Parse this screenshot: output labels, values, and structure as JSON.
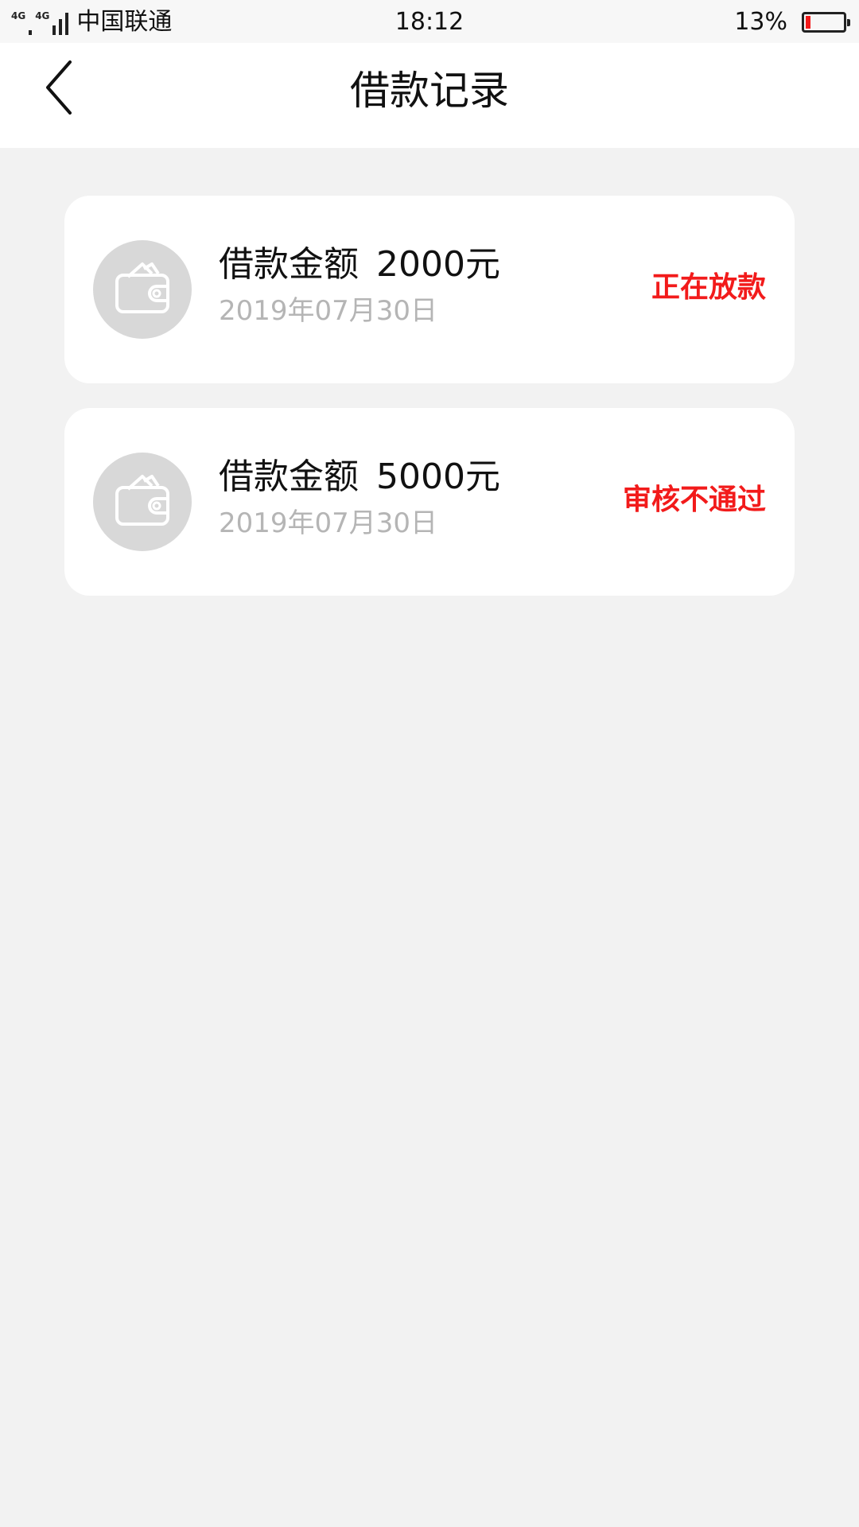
{
  "status_bar": {
    "network_tag_1": "4G",
    "network_tag_2": "4G",
    "carrier": "中国联通",
    "time": "18:12",
    "battery_percent_text": "13%",
    "battery_level": 0.13
  },
  "nav": {
    "title": "借款记录",
    "back_icon": "chevron-left-icon"
  },
  "records": [
    {
      "icon": "wallet-icon",
      "amount_label": "借款金额",
      "amount_value": "2000元",
      "date": "2019年07月30日",
      "status": "正在放款"
    },
    {
      "icon": "wallet-icon",
      "amount_label": "借款金额",
      "amount_value": "5000元",
      "date": "2019年07月30日",
      "status": "审核不通过"
    }
  ],
  "colors": {
    "status_red": "#f21b1b",
    "page_bg": "#f2f2f2",
    "card_bg": "#ffffff",
    "avatar_bg": "#d8d8d8",
    "date_gray": "#b5b5b5"
  }
}
